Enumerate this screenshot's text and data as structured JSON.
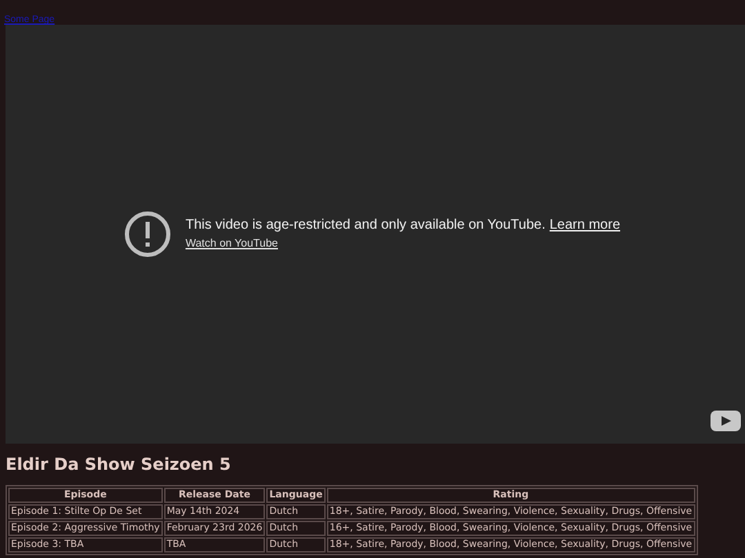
{
  "link": "Some Page",
  "video": {
    "message": "This video is age-restricted and only available on YouTube.",
    "learn_more": "Learn more",
    "watch": "Watch on YouTube"
  },
  "heading": "Eldir Da Show Seizoen 5",
  "table": {
    "columns": [
      "Episode",
      "Release Date",
      "Language",
      "Rating"
    ],
    "rows": [
      [
        "Episode 1: Stilte Op De Set",
        "May 14th 2024",
        "Dutch",
        "18+, Satire, Parody, Blood, Swearing, Violence, Sexuality, Drugs, Offensive"
      ],
      [
        "Episode 2: Aggressive Timothy",
        "February 23rd 2026",
        "Dutch",
        "16+, Satire, Parody, Blood, Swearing, Violence, Sexuality, Drugs, Offensive"
      ],
      [
        "Episode 3: TBA",
        "TBA",
        "Dutch",
        "18+, Satire, Parody, Blood, Swearing, Violence, Sexuality, Drugs, Offensive"
      ]
    ]
  }
}
